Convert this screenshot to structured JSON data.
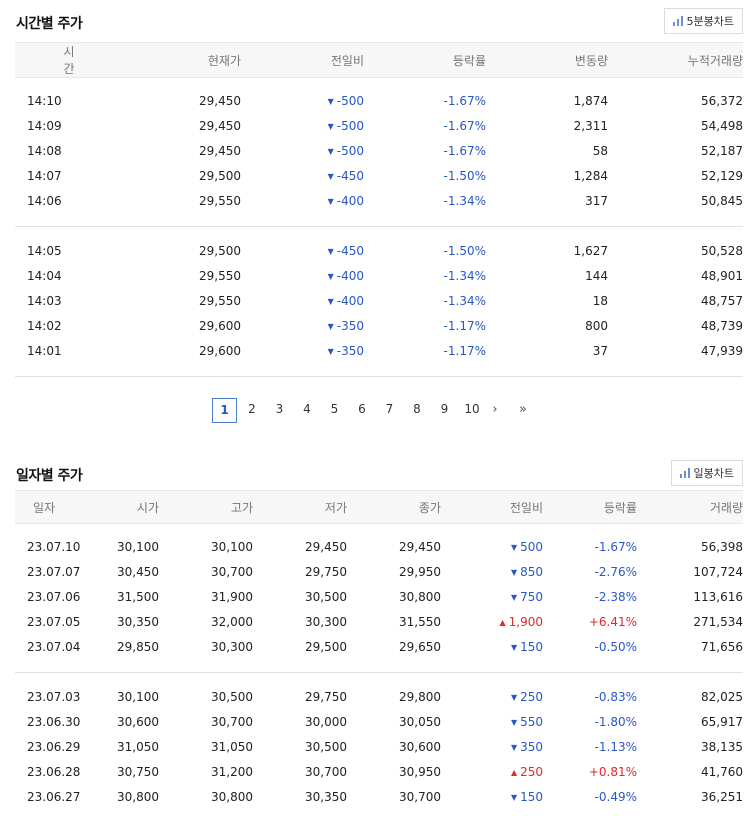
{
  "time_section": {
    "title": "시간별 주가",
    "chart_button": "5분봉차트",
    "headers": [
      "시간",
      "현재가",
      "전일비",
      "등락률",
      "변동량",
      "누적거래량"
    ],
    "group1": [
      {
        "time": "14:10",
        "price": "29,450",
        "change": "-500",
        "rate": "-1.67%",
        "volume": "1,874",
        "cum": "56,372"
      },
      {
        "time": "14:09",
        "price": "29,450",
        "change": "-500",
        "rate": "-1.67%",
        "volume": "2,311",
        "cum": "54,498"
      },
      {
        "time": "14:08",
        "price": "29,450",
        "change": "-500",
        "rate": "-1.67%",
        "volume": "58",
        "cum": "52,187"
      },
      {
        "time": "14:07",
        "price": "29,500",
        "change": "-450",
        "rate": "-1.50%",
        "volume": "1,284",
        "cum": "52,129"
      },
      {
        "time": "14:06",
        "price": "29,550",
        "change": "-400",
        "rate": "-1.34%",
        "volume": "317",
        "cum": "50,845"
      }
    ],
    "group2": [
      {
        "time": "14:05",
        "price": "29,500",
        "change": "-450",
        "rate": "-1.50%",
        "volume": "1,627",
        "cum": "50,528"
      },
      {
        "time": "14:04",
        "price": "29,550",
        "change": "-400",
        "rate": "-1.34%",
        "volume": "144",
        "cum": "48,901"
      },
      {
        "time": "14:03",
        "price": "29,550",
        "change": "-400",
        "rate": "-1.34%",
        "volume": "18",
        "cum": "48,757"
      },
      {
        "time": "14:02",
        "price": "29,600",
        "change": "-350",
        "rate": "-1.17%",
        "volume": "800",
        "cum": "48,739"
      },
      {
        "time": "14:01",
        "price": "29,600",
        "change": "-350",
        "rate": "-1.17%",
        "volume": "37",
        "cum": "47,939"
      }
    ]
  },
  "pagination": {
    "pages": [
      "1",
      "2",
      "3",
      "4",
      "5",
      "6",
      "7",
      "8",
      "9",
      "10"
    ],
    "active": "1",
    "next": "›",
    "last": "»"
  },
  "daily_section": {
    "title": "일자별 주가",
    "chart_button": "일봉차트",
    "headers": [
      "일자",
      "시가",
      "고가",
      "저가",
      "종가",
      "전일비",
      "등락률",
      "거래량"
    ],
    "group1": [
      {
        "date": "23.07.10",
        "open": "30,100",
        "high": "30,100",
        "low": "29,450",
        "close": "29,450",
        "dir": "down",
        "change": "500",
        "rate": "-1.67%",
        "volume": "56,398"
      },
      {
        "date": "23.07.07",
        "open": "30,450",
        "high": "30,700",
        "low": "29,750",
        "close": "29,950",
        "dir": "down",
        "change": "850",
        "rate": "-2.76%",
        "volume": "107,724"
      },
      {
        "date": "23.07.06",
        "open": "31,500",
        "high": "31,900",
        "low": "30,500",
        "close": "30,800",
        "dir": "down",
        "change": "750",
        "rate": "-2.38%",
        "volume": "113,616"
      },
      {
        "date": "23.07.05",
        "open": "30,350",
        "high": "32,000",
        "low": "30,300",
        "close": "31,550",
        "dir": "up",
        "change": "1,900",
        "rate": "+6.41%",
        "volume": "271,534"
      },
      {
        "date": "23.07.04",
        "open": "29,850",
        "high": "30,300",
        "low": "29,500",
        "close": "29,650",
        "dir": "down",
        "change": "150",
        "rate": "-0.50%",
        "volume": "71,656"
      }
    ],
    "group2": [
      {
        "date": "23.07.03",
        "open": "30,100",
        "high": "30,500",
        "low": "29,750",
        "close": "29,800",
        "dir": "down",
        "change": "250",
        "rate": "-0.83%",
        "volume": "82,025"
      },
      {
        "date": "23.06.30",
        "open": "30,600",
        "high": "30,700",
        "low": "30,000",
        "close": "30,050",
        "dir": "down",
        "change": "550",
        "rate": "-1.80%",
        "volume": "65,917"
      },
      {
        "date": "23.06.29",
        "open": "31,050",
        "high": "31,050",
        "low": "30,500",
        "close": "30,600",
        "dir": "down",
        "change": "350",
        "rate": "-1.13%",
        "volume": "38,135"
      },
      {
        "date": "23.06.28",
        "open": "30,750",
        "high": "31,200",
        "low": "30,700",
        "close": "30,950",
        "dir": "up",
        "change": "250",
        "rate": "+0.81%",
        "volume": "41,760"
      },
      {
        "date": "23.06.27",
        "open": "30,800",
        "high": "30,800",
        "low": "30,350",
        "close": "30,700",
        "dir": "down",
        "change": "150",
        "rate": "-0.49%",
        "volume": "36,251"
      }
    ]
  },
  "colors": {
    "down": "#2a57c7",
    "up": "#e02a2a",
    "active_page_border": "#4a7fd0"
  },
  "icons": {
    "down_arrow": "▼",
    "up_arrow": "▲",
    "chart_icon": "bar-chart-icon"
  }
}
